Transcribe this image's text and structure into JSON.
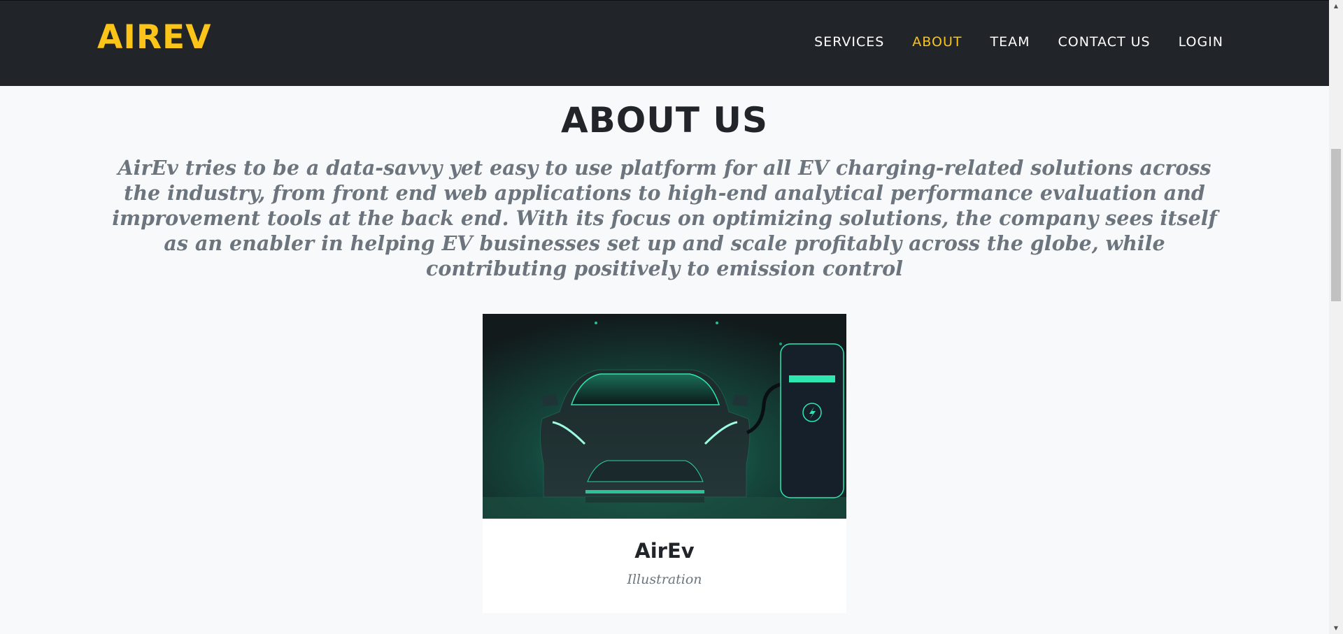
{
  "navbar": {
    "brand": "AIREV",
    "items": [
      {
        "label": "SERVICES",
        "active": false
      },
      {
        "label": "ABOUT",
        "active": true
      },
      {
        "label": "TEAM",
        "active": false
      },
      {
        "label": "CONTACT US",
        "active": false
      },
      {
        "label": "LOGIN",
        "active": false
      }
    ]
  },
  "about": {
    "heading": "ABOUT US",
    "subheading": "AirEv tries to be a data-savvy yet easy to use platform for all EV charging-related solutions across the industry, from front end web applications to high-end analytical performance evaluation and improvement tools at the back end. With its focus on optimizing solutions, the company sees itself as an enabler in helping EV businesses set up and scale profitably across the globe, while contributing positively to emission control"
  },
  "portfolio_item": {
    "title": "AirEv",
    "subtitle": "Illustration",
    "image_icon": "electric-car-charging-illustration"
  },
  "colors": {
    "navbar_bg": "#212529",
    "brand_accent": "#fcc318",
    "page_bg": "#f8f9fa",
    "heading_text": "#212529",
    "muted_text": "#6c757d",
    "illustration_green": "#2ee6b0"
  },
  "icons": {
    "scroll_up": "scroll-up-arrow-icon",
    "scroll_down": "scroll-down-arrow-icon",
    "lightning": "lightning-bolt-icon"
  }
}
